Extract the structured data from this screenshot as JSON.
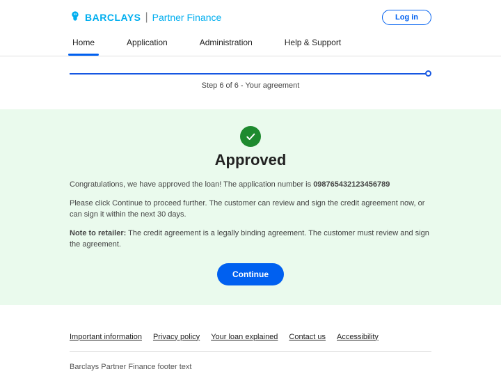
{
  "brand": {
    "main": "BARCLAYS",
    "sub": "Partner Finance"
  },
  "header": {
    "login_label": "Log in"
  },
  "nav": {
    "items": [
      {
        "label": "Home",
        "active": true
      },
      {
        "label": "Application",
        "active": false
      },
      {
        "label": "Administration",
        "active": false
      },
      {
        "label": "Help & Support",
        "active": false
      }
    ]
  },
  "progress": {
    "label": "Step 6 of 6 - Your agreement"
  },
  "approved": {
    "title": "Approved",
    "msg_prefix": "Congratulations, we have approved the loan! The application number is ",
    "application_number": "098765432123456789",
    "msg2": "Please click Continue to proceed further. The customer can review and sign the credit agreement now, or can sign it within the next 30 days.",
    "note_label": "Note to retailer:",
    "note_text": " The credit agreement is a legally binding agreement. The customer must review and sign the agreement.",
    "continue_label": "Continue"
  },
  "footer": {
    "links": [
      "Important information",
      "Privacy policy",
      "Your loan explained",
      "Contact us",
      "Accessibility"
    ],
    "text": "Barclays Partner Finance footer text"
  },
  "colors": {
    "brand_blue": "#00aeef",
    "primary_blue": "#0060f0",
    "success_green": "#1e8a2f",
    "success_bg": "#eafaed"
  }
}
